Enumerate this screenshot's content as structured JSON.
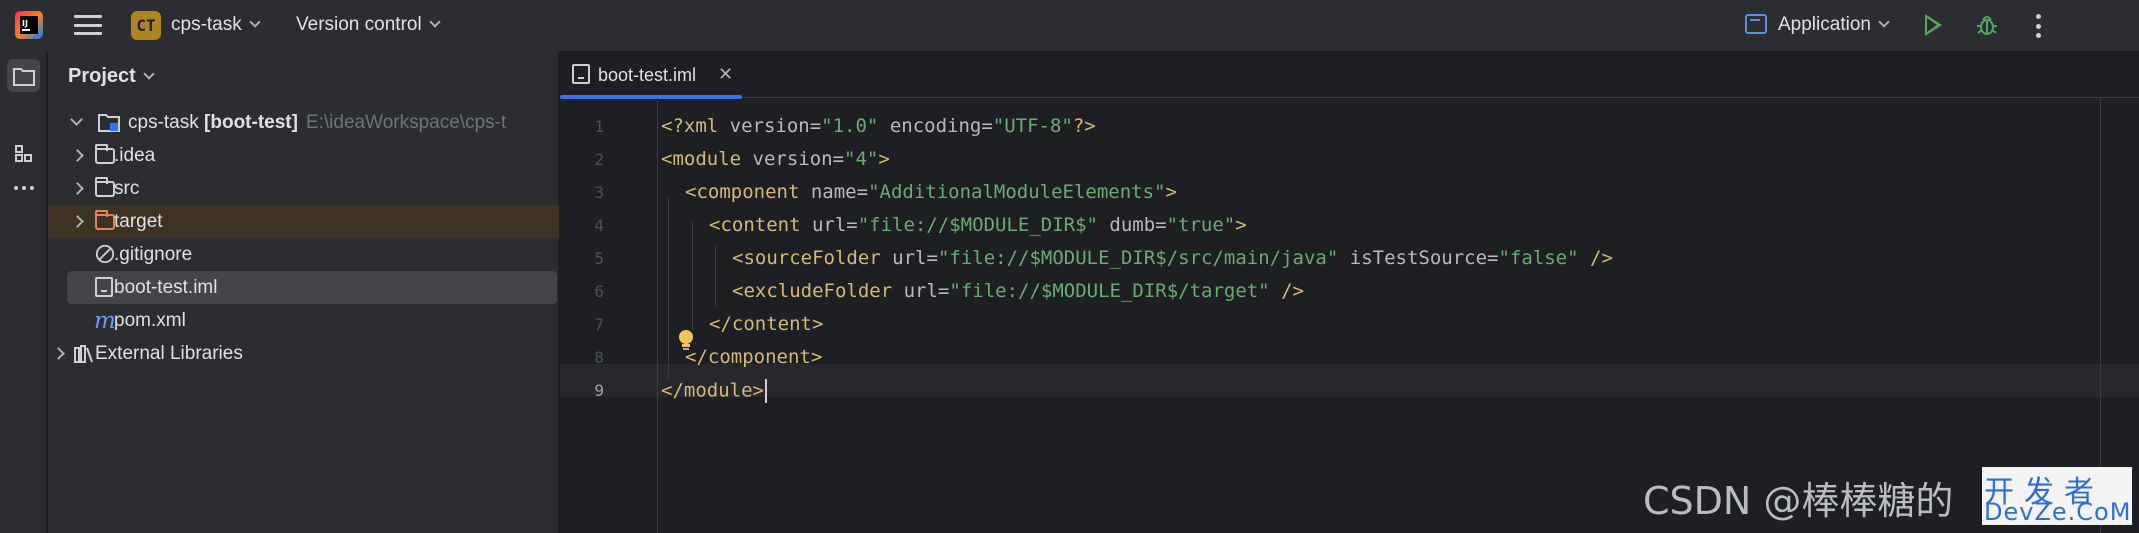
{
  "titlebar": {
    "project_badge": "CT",
    "project_name": "cps-task",
    "vcs_label": "Version control",
    "run_config": "Application"
  },
  "project_pane": {
    "title": "Project",
    "tree": [
      {
        "label": "cps-task",
        "suffix": "[boot-test]",
        "path": "E:\\ideaWorkspace\\cps-t"
      },
      {
        "label": ".idea"
      },
      {
        "label": "src"
      },
      {
        "label": "target"
      },
      {
        "label": ".gitignore"
      },
      {
        "label": "boot-test.iml"
      },
      {
        "label": "pom.xml"
      },
      {
        "label": "External Libraries"
      }
    ]
  },
  "editor": {
    "tab_label": "boot-test.iml",
    "line_numbers": [
      "1",
      "2",
      "3",
      "4",
      "5",
      "6",
      "7",
      "8",
      "9"
    ],
    "current_line": "9",
    "code": {
      "l1": {
        "open": "<?xml ",
        "a1": "version",
        "eq1": "=",
        "v1": "\"1.0\"",
        "a2": " encoding",
        "eq2": "=",
        "v2": "\"UTF-8\"",
        "close": "?>"
      },
      "l2": {
        "open": "<module ",
        "a1": "version",
        "eq1": "=",
        "v1": "\"4\"",
        "close": ">"
      },
      "l3": {
        "open": "<component ",
        "a1": "name",
        "eq1": "=",
        "v1": "\"AdditionalModuleElements\"",
        "close": ">"
      },
      "l4": {
        "open": "<content ",
        "a1": "url",
        "eq1": "=",
        "v1": "\"file://$MODULE_DIR$\"",
        "a2": " dumb",
        "eq2": "=",
        "v2": "\"true\"",
        "close": ">"
      },
      "l5": {
        "open": "<sourceFolder ",
        "a1": "url",
        "eq1": "=",
        "v1": "\"file://$MODULE_DIR$/src/main/java\"",
        "a2": " isTestSource",
        "eq2": "=",
        "v2": "\"false\"",
        "close": " />"
      },
      "l6": {
        "open": "<excludeFolder ",
        "a1": "url",
        "eq1": "=",
        "v1": "\"file://$MODULE_DIR$/target\"",
        "close": " />"
      },
      "l7": {
        "text": "</content>"
      },
      "l8": {
        "text": "</component>"
      },
      "l9": {
        "text": "</module>"
      }
    }
  },
  "watermark": {
    "text": "CSDN @棒棒糖的",
    "badge_line1": "开发者",
    "badge_line2": "DevZe.CoM"
  },
  "colors": {
    "accent": "#3574f0",
    "xml_tag": "#d5b778",
    "xml_value": "#6aab73",
    "run_green": "#57a65d",
    "project_badge": "#b08420"
  }
}
